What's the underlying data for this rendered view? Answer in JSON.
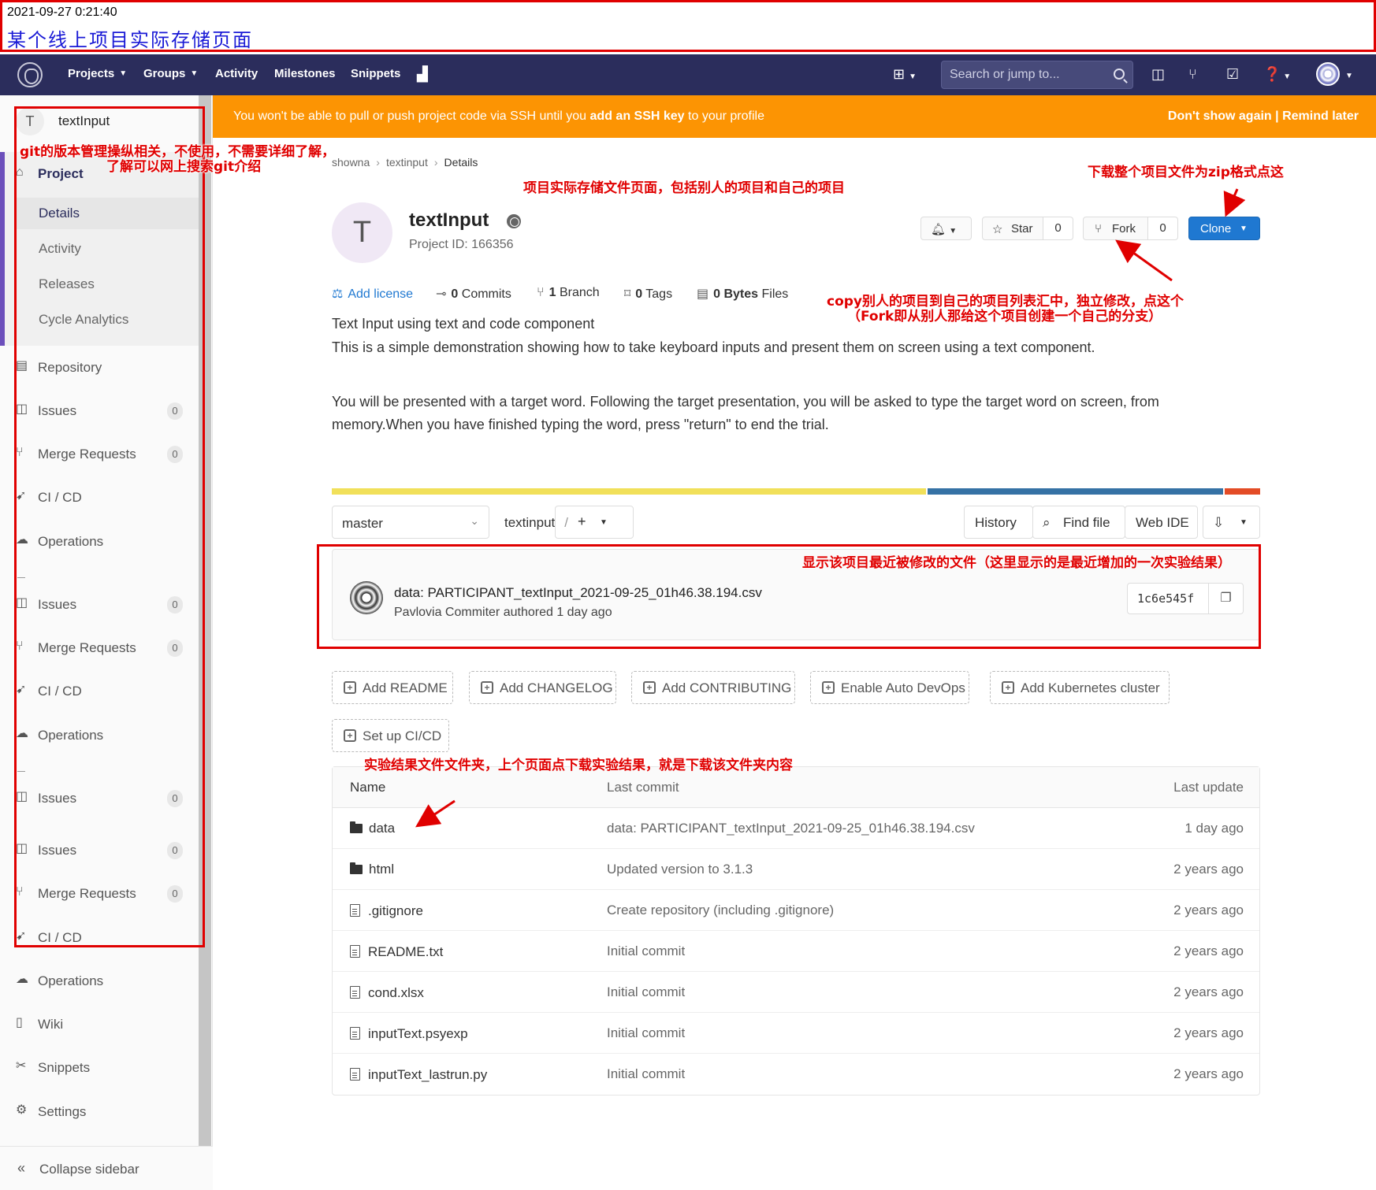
{
  "note": {
    "timestamp": "2021-09-27 0:21:40",
    "title": "某个线上项目实际存储页面"
  },
  "navbar": {
    "projects": "Projects",
    "groups": "Groups",
    "activity": "Activity",
    "milestones": "Milestones",
    "snippets": "Snippets",
    "search_placeholder": "Search or jump to..."
  },
  "sidebar": {
    "project_initial": "T",
    "project_name": "textInput",
    "project_label": "Project",
    "sub_items": [
      "Details",
      "Activity",
      "Releases",
      "Cycle Analytics"
    ],
    "items": [
      {
        "label": "Repository",
        "badge": ""
      },
      {
        "label": "Issues",
        "badge": "0"
      },
      {
        "label": "Merge Requests",
        "badge": "0"
      },
      {
        "label": "CI / CD",
        "badge": ""
      },
      {
        "label": "Operations",
        "badge": ""
      },
      {
        "label": "Issues",
        "badge": "0"
      },
      {
        "label": "Merge Requests",
        "badge": "0"
      },
      {
        "label": "CI / CD",
        "badge": ""
      },
      {
        "label": "Operations",
        "badge": ""
      },
      {
        "label": "Issues",
        "badge": "0"
      },
      {
        "label": "Issues",
        "badge": "0"
      },
      {
        "label": "Merge Requests",
        "badge": "0"
      },
      {
        "label": "CI / CD",
        "badge": ""
      },
      {
        "label": "Operations",
        "badge": ""
      },
      {
        "label": "Wiki",
        "badge": ""
      },
      {
        "label": "Snippets",
        "badge": ""
      },
      {
        "label": "Settings",
        "badge": ""
      }
    ],
    "collapse": "Collapse sidebar"
  },
  "alert": {
    "text_before": "You won't be able to pull or push project code via SSH until you ",
    "link": "add an SSH key",
    "text_after": " to your profile",
    "dont_show": "Don't show again",
    "separator": " | ",
    "remind": "Remind later"
  },
  "breadcrumb": [
    "showna",
    "textinput",
    "Details"
  ],
  "project": {
    "initial": "T",
    "name": "textInput",
    "id_text": "Project ID: 166356",
    "star_label": "Star",
    "star_count": "0",
    "fork_label": "Fork",
    "fork_count": "0",
    "clone_label": "Clone"
  },
  "stats": {
    "add_license": "Add license",
    "commits_num": "0",
    "commits_label": " Commits",
    "branch_num": "1",
    "branch_label": " Branch",
    "tags_num": "0",
    "tags_label": " Tags",
    "files_num": "0 Bytes",
    "files_label": " Files"
  },
  "description": {
    "line1": "Text Input using text and code component",
    "line2": "This is a simple demonstration showing how to take keyboard inputs and present them on screen using a text component.",
    "line3": "You will be presented with a target word. Following the target presentation, you will be asked to type the target word on screen, from",
    "line4": "memory.When you have finished typing the word, press \"return\" to end the trial."
  },
  "language_bar": [
    {
      "share": 0.642,
      "color": "#f1e05a"
    },
    {
      "share": 0.32,
      "color": "#3572a5"
    },
    {
      "share": 0.038,
      "color": "#e34c26"
    }
  ],
  "toolbar": {
    "branch": "master",
    "path": "textinput",
    "path_sep": "/",
    "plus": "+",
    "history": "History",
    "find_file": "Find file",
    "web_ide": "Web IDE"
  },
  "last_commit": {
    "title": "data: PARTICIPANT_textInput_2021-09-25_01h46.38.194.csv",
    "meta": "Pavlovia Commiter authored 1 day ago",
    "sha": "1c6e545f"
  },
  "actions": [
    "Add README",
    "Add CHANGELOG",
    "Add CONTRIBUTING",
    "Enable Auto DevOps",
    "Add Kubernetes cluster",
    "Set up CI/CD"
  ],
  "files": {
    "headers": {
      "name": "Name",
      "commit": "Last commit",
      "update": "Last update"
    },
    "rows": [
      {
        "type": "folder",
        "name": "data",
        "commit": "data: PARTICIPANT_textInput_2021-09-25_01h46.38.194.csv",
        "update": "1 day ago"
      },
      {
        "type": "folder",
        "name": "html",
        "commit": "Updated version to 3.1.3",
        "update": "2 years ago"
      },
      {
        "type": "file",
        "name": ".gitignore",
        "commit": "Create repository (including .gitignore)",
        "update": "2 years ago"
      },
      {
        "type": "file",
        "name": "README.txt",
        "commit": "Initial commit",
        "update": "2 years ago"
      },
      {
        "type": "file",
        "name": "cond.xlsx",
        "commit": "Initial commit",
        "update": "2 years ago"
      },
      {
        "type": "file",
        "name": "inputText.psyexp",
        "commit": "Initial commit",
        "update": "2 years ago"
      },
      {
        "type": "file",
        "name": "inputText_lastrun.py",
        "commit": "Initial commit",
        "update": "2 years ago"
      }
    ]
  },
  "annotations": {
    "sidebar_note_1": "git的版本管理操纵相关，不使用，不需要详细了解，",
    "sidebar_note_2": "了解可以网上搜索git介绍",
    "storage_note": "项目实际存储文件页面，包括别人的项目和自己的项目",
    "clone_note": "下载整个项目文件为zip格式点这",
    "fork_note_1": "copy别人的项目到自己的项目列表汇中，独立修改，点这个",
    "fork_note_2": "（Fork即从别人那给这个项目创建一个自己的分支）",
    "commit_note": "显示该项目最近被修改的文件（这里显示的是最近增加的一次实验结果）",
    "data_note": "实验结果文件文件夹，上个页面点下载实验结果，就是下载该文件夹内容"
  }
}
